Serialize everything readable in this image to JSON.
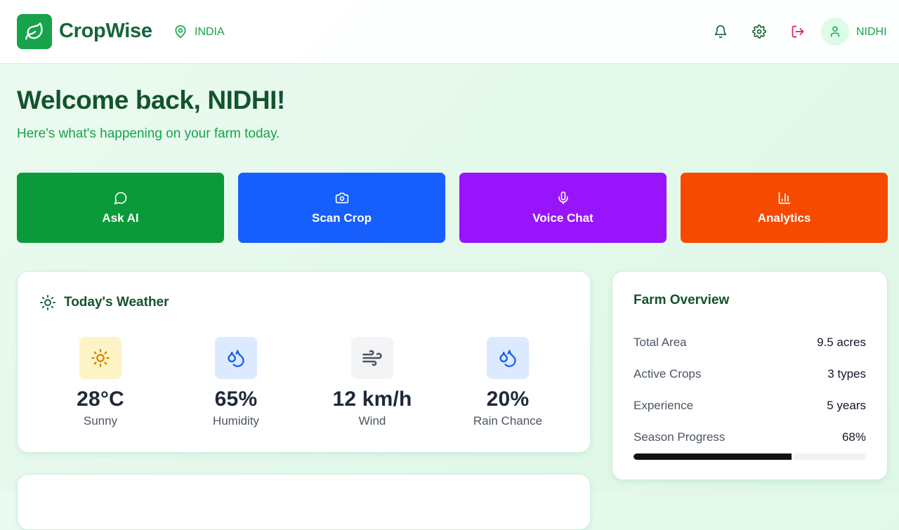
{
  "header": {
    "brand": "CropWise",
    "location": "INDIA",
    "user_name": "NIDHI",
    "icons": [
      "leaf-icon",
      "map-pin-icon",
      "bell-icon",
      "gear-icon",
      "logout-icon",
      "user-icon"
    ]
  },
  "welcome": {
    "title": "Welcome back, NIDHI!",
    "subtitle": "Here's what's happening on your farm today."
  },
  "actions": [
    {
      "label": "Ask AI",
      "icon": "chat-bubble-icon",
      "color": "#0b9a3a"
    },
    {
      "label": "Scan Crop",
      "icon": "camera-icon",
      "color": "#175ffc"
    },
    {
      "label": "Voice Chat",
      "icon": "microphone-icon",
      "color": "#9814fb"
    },
    {
      "label": "Analytics",
      "icon": "bar-chart-icon",
      "color": "#f54a00"
    }
  ],
  "weather": {
    "title": "Today's Weather",
    "items": [
      {
        "value": "28°C",
        "label": "Sunny",
        "icon": "sun-icon",
        "tile": "#fef3c6"
      },
      {
        "value": "65%",
        "label": "Humidity",
        "icon": "droplets-icon",
        "tile": "#dbeafe"
      },
      {
        "value": "12 km/h",
        "label": "Wind",
        "icon": "wind-icon",
        "tile": "#f3f4f6"
      },
      {
        "value": "20%",
        "label": "Rain Chance",
        "icon": "droplets-icon",
        "tile": "#dbeafe"
      }
    ]
  },
  "farm": {
    "title": "Farm Overview",
    "rows": [
      {
        "label": "Total Area",
        "value": "9.5 acres"
      },
      {
        "label": "Active Crops",
        "value": "3 types"
      },
      {
        "label": "Experience",
        "value": "5 years"
      },
      {
        "label": "Season Progress",
        "value": "68%"
      }
    ],
    "season_progress": 0.68
  },
  "colors": {
    "brand_green": "#17a34a",
    "dark_green": "#14532d",
    "logout_red": "#e11d48"
  }
}
